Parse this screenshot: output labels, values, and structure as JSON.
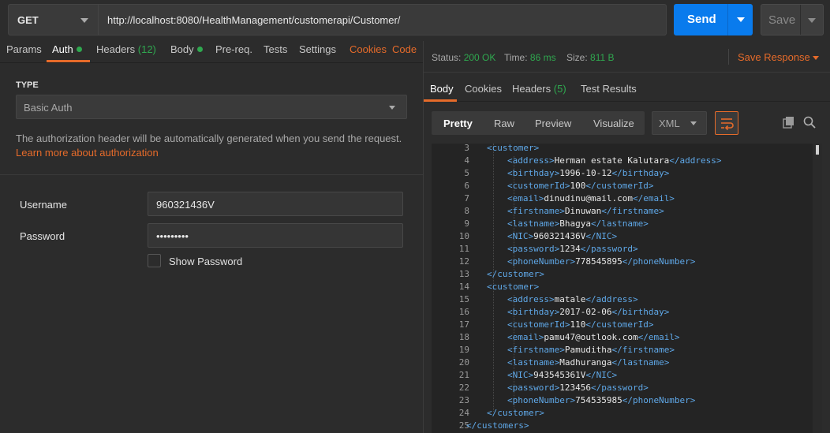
{
  "request": {
    "method": "GET",
    "url": "http://localhost:8080/HealthManagement/customerapi/Customer/",
    "send_label": "Send",
    "save_label": "Save"
  },
  "request_tabs": {
    "params": "Params",
    "auth": "Auth",
    "headers": "Headers",
    "headers_count": "(12)",
    "body": "Body",
    "prereq": "Pre-req.",
    "tests": "Tests",
    "settings": "Settings",
    "cookies": "Cookies",
    "code": "Code"
  },
  "auth": {
    "type_label": "TYPE",
    "type_value": "Basic Auth",
    "description": "The authorization header will be automatically generated when you send the request.",
    "learn_more": "Learn more about authorization",
    "username_label": "Username",
    "username_value": "960321436V",
    "password_label": "Password",
    "password_value": "•••••••••",
    "show_password": "Show Password"
  },
  "response": {
    "status_label": "Status:",
    "status_value": "200 OK",
    "time_label": "Time:",
    "time_value": "86 ms",
    "size_label": "Size:",
    "size_value": "811 B",
    "save_response": "Save Response",
    "tabs": {
      "body": "Body",
      "cookies": "Cookies",
      "headers": "Headers",
      "headers_count": "(5)",
      "test_results": "Test Results"
    },
    "view_modes": [
      "Pretty",
      "Raw",
      "Preview",
      "Visualize"
    ],
    "format": "XML"
  },
  "colors": {
    "accent": "#e66b2a",
    "send": "#097bed",
    "success": "#2fa84f",
    "xml_tag": "#5fa8e8"
  },
  "code_lines": [
    {
      "n": "3",
      "indent": 1,
      "tag": "customer",
      "value": "",
      "close": false,
      "open_only": true
    },
    {
      "n": "4",
      "indent": 2,
      "tag": "address",
      "value": "Herman estate Kalutara"
    },
    {
      "n": "5",
      "indent": 2,
      "tag": "birthday",
      "value": "1996-10-12"
    },
    {
      "n": "6",
      "indent": 2,
      "tag": "customerId",
      "value": "100"
    },
    {
      "n": "7",
      "indent": 2,
      "tag": "email",
      "value": "dinudinu@mail.com"
    },
    {
      "n": "8",
      "indent": 2,
      "tag": "firstname",
      "value": "Dinuwan"
    },
    {
      "n": "9",
      "indent": 2,
      "tag": "lastname",
      "value": "Bhagya"
    },
    {
      "n": "10",
      "indent": 2,
      "tag": "NIC",
      "value": "960321436V"
    },
    {
      "n": "11",
      "indent": 2,
      "tag": "password",
      "value": "1234"
    },
    {
      "n": "12",
      "indent": 2,
      "tag": "phoneNumber",
      "value": "778545895"
    },
    {
      "n": "13",
      "indent": 1,
      "tag": "customer",
      "value": "",
      "close_only": true
    },
    {
      "n": "14",
      "indent": 1,
      "tag": "customer",
      "value": "",
      "open_only": true
    },
    {
      "n": "15",
      "indent": 2,
      "tag": "address",
      "value": "matale"
    },
    {
      "n": "16",
      "indent": 2,
      "tag": "birthday",
      "value": "2017-02-06"
    },
    {
      "n": "17",
      "indent": 2,
      "tag": "customerId",
      "value": "110"
    },
    {
      "n": "18",
      "indent": 2,
      "tag": "email",
      "value": "pamu47@outlook.com"
    },
    {
      "n": "19",
      "indent": 2,
      "tag": "firstname",
      "value": "Pamuditha"
    },
    {
      "n": "20",
      "indent": 2,
      "tag": "lastname",
      "value": "Madhuranga"
    },
    {
      "n": "21",
      "indent": 2,
      "tag": "NIC",
      "value": "943545361V"
    },
    {
      "n": "22",
      "indent": 2,
      "tag": "password",
      "value": "123456"
    },
    {
      "n": "23",
      "indent": 2,
      "tag": "phoneNumber",
      "value": "754535985"
    },
    {
      "n": "24",
      "indent": 1,
      "tag": "customer",
      "value": "",
      "close_only": true
    },
    {
      "n": "25",
      "indent": 0,
      "tag": "customers",
      "value": "",
      "close_only": true
    }
  ]
}
